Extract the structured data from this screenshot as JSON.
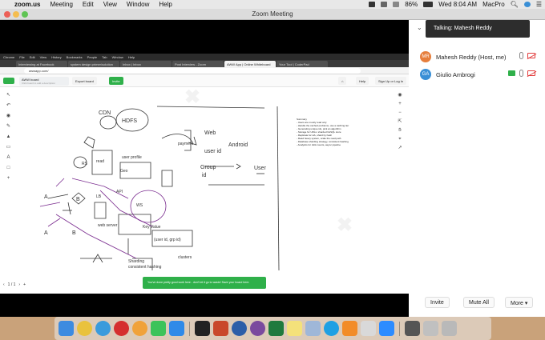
{
  "menubar": {
    "apple_glyph": "",
    "app_name": "zoom.us",
    "items": [
      "Meeting",
      "Edit",
      "View",
      "Window",
      "Help"
    ],
    "battery": "86%",
    "clock": "Wed 8:04 AM",
    "machine": "MacPro"
  },
  "window": {
    "title": "Zoom Meeting"
  },
  "shared_screen": {
    "chrome_menu": [
      "Chrome",
      "File",
      "Edit",
      "View",
      "History",
      "Bookmarks",
      "People",
      "Tab",
      "Window",
      "Help"
    ],
    "tabs": [
      "Interviewing at Facebook",
      "system design primer/solution",
      "Inbox | Inbox",
      "Post Interview - Zoom",
      "AWW App | Online Whiteboard",
      "Your Tool | CoderPad"
    ],
    "active_tab_index": 4,
    "url": "awwapp.com/",
    "board_title": "AWW board",
    "board_subtitle": "Click board to add a description",
    "export_label": "Export board",
    "invite_label": "Invite",
    "help_label": "Help",
    "signup_label": "Sign Up or Log In",
    "pager_label": "1 / 1",
    "toast_text": "You've done pretty good work here - don't let it go to waste! Save your board here.",
    "notes": [
      "Summary",
      "- Users are mostly read only",
      "- Handle the cached problems, use a caching tier",
      "- Generating unique ids, pick an algorithm",
      "- Storage for URLs: sharded NoSQL store",
      "- Replicate for HA, shard by hash",
      "- Read heavy system, scale the read path",
      "- Database sharding strategy, consistent hashing",
      "- Analytics for click counts, async pipeline"
    ],
    "sketch_labels": {
      "cdn": "CDN",
      "hdfs": "HDFS",
      "web": "Web",
      "android": "Android",
      "user_id": "user id",
      "group": "Group",
      "user": "User",
      "group_id": "id",
      "geo": "Geo",
      "user_profile": "user profile",
      "payment": "payment",
      "read": "read",
      "rs": "RS",
      "api": "API",
      "lb": "LB",
      "web_server": "web server",
      "ws": "WS",
      "key_value": "Key Value",
      "sharding": "Sharding",
      "consistent_hashing": "consistent hashing",
      "clusters": "clusters",
      "shard_key": "(user id, grp id)",
      "a1": "A",
      "b1": "B",
      "a2": "A",
      "b2": "B"
    }
  },
  "participants": {
    "talking_banner": "Talking: Mahesh Reddy",
    "list": [
      {
        "initials": "MR",
        "name": "Mahesh Reddy (Host, me)",
        "color": "#e67e3c"
      },
      {
        "initials": "GA",
        "name": "Giulio Ambrogi",
        "color": "#3a8fd6"
      }
    ],
    "invite_label": "Invite",
    "mute_all_label": "Mute All",
    "more_label": "More"
  },
  "dock": {
    "apps": [
      {
        "name": "finder-icon",
        "color": "#3d8be0"
      },
      {
        "name": "chrome-icon",
        "color": "#e9c23d"
      },
      {
        "name": "safari-icon",
        "color": "#3a9bdc"
      },
      {
        "name": "opera-icon",
        "color": "#d52f2f"
      },
      {
        "name": "photos-icon",
        "color": "#f0a23a"
      },
      {
        "name": "facetime-icon",
        "color": "#3cc35a"
      },
      {
        "name": "app-store-icon",
        "color": "#2f8ae8"
      },
      {
        "name": "terminal-icon",
        "color": "#222222"
      },
      {
        "name": "powerpoint-icon",
        "color": "#c9482b"
      },
      {
        "name": "quicktime-icon",
        "color": "#2c5ea8"
      },
      {
        "name": "tor-icon",
        "color": "#7a4a9e"
      },
      {
        "name": "excel-icon",
        "color": "#1f7a3e"
      },
      {
        "name": "notes-icon",
        "color": "#f4e17a"
      },
      {
        "name": "preview-icon",
        "color": "#9fb7d8"
      },
      {
        "name": "skype-icon",
        "color": "#1fa0e3"
      },
      {
        "name": "sublime-icon",
        "color": "#f28c28"
      },
      {
        "name": "textedit-icon",
        "color": "#d9d9d9"
      },
      {
        "name": "zoom-icon",
        "color": "#2d8cff"
      },
      {
        "name": "screenshot-icon",
        "color": "#555555"
      },
      {
        "name": "network-icon",
        "color": "#c0c0c0"
      },
      {
        "name": "trash-icon",
        "color": "#b9b9b9"
      }
    ]
  }
}
